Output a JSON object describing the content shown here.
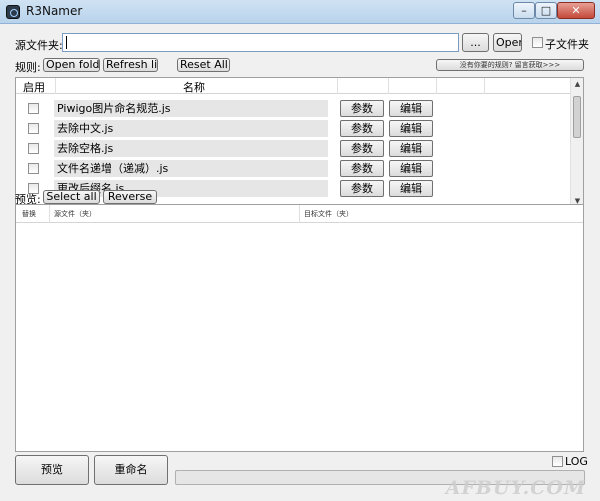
{
  "window": {
    "title": "R3Namer",
    "minimize_glyph": "–",
    "maximize_glyph": "□",
    "close_glyph": "✕"
  },
  "source": {
    "label": "源文件夹:",
    "value": "",
    "browse_label": "...",
    "open_label": "Open",
    "subfolder_label": "子文件夹",
    "subfolder_checked": false
  },
  "rules": {
    "label": "规则:",
    "open_folder_label": "Open folder",
    "refresh_list_label": "Refresh list",
    "reset_all_label": "Reset All",
    "get_more_label": "没有你要的规则? 留言获取>>>",
    "columns": {
      "enabled": "启用",
      "name": "名称"
    },
    "items": [
      {
        "enabled": false,
        "name": "Piwigo图片命名规范.js",
        "params_label": "参数",
        "edit_label": "编辑"
      },
      {
        "enabled": false,
        "name": "去除中文.js",
        "params_label": "参数",
        "edit_label": "编辑"
      },
      {
        "enabled": false,
        "name": "去除空格.js",
        "params_label": "参数",
        "edit_label": "编辑"
      },
      {
        "enabled": false,
        "name": "文件名递增（递减）.js",
        "params_label": "参数",
        "edit_label": "编辑"
      },
      {
        "enabled": false,
        "name": "更改后缀名.js",
        "params_label": "参数",
        "edit_label": "编辑"
      }
    ]
  },
  "preview": {
    "label": "预览:",
    "select_all_label": "Select all",
    "reverse_label": "Reverse",
    "columns": {
      "replace": "替换",
      "source": "源文件（夹）",
      "target": "目标文件（夹）"
    }
  },
  "footer": {
    "preview_button": "预览",
    "rename_button": "重命名",
    "log_label": "LOG",
    "log_checked": false
  },
  "watermark": "AFBUY.COM"
}
